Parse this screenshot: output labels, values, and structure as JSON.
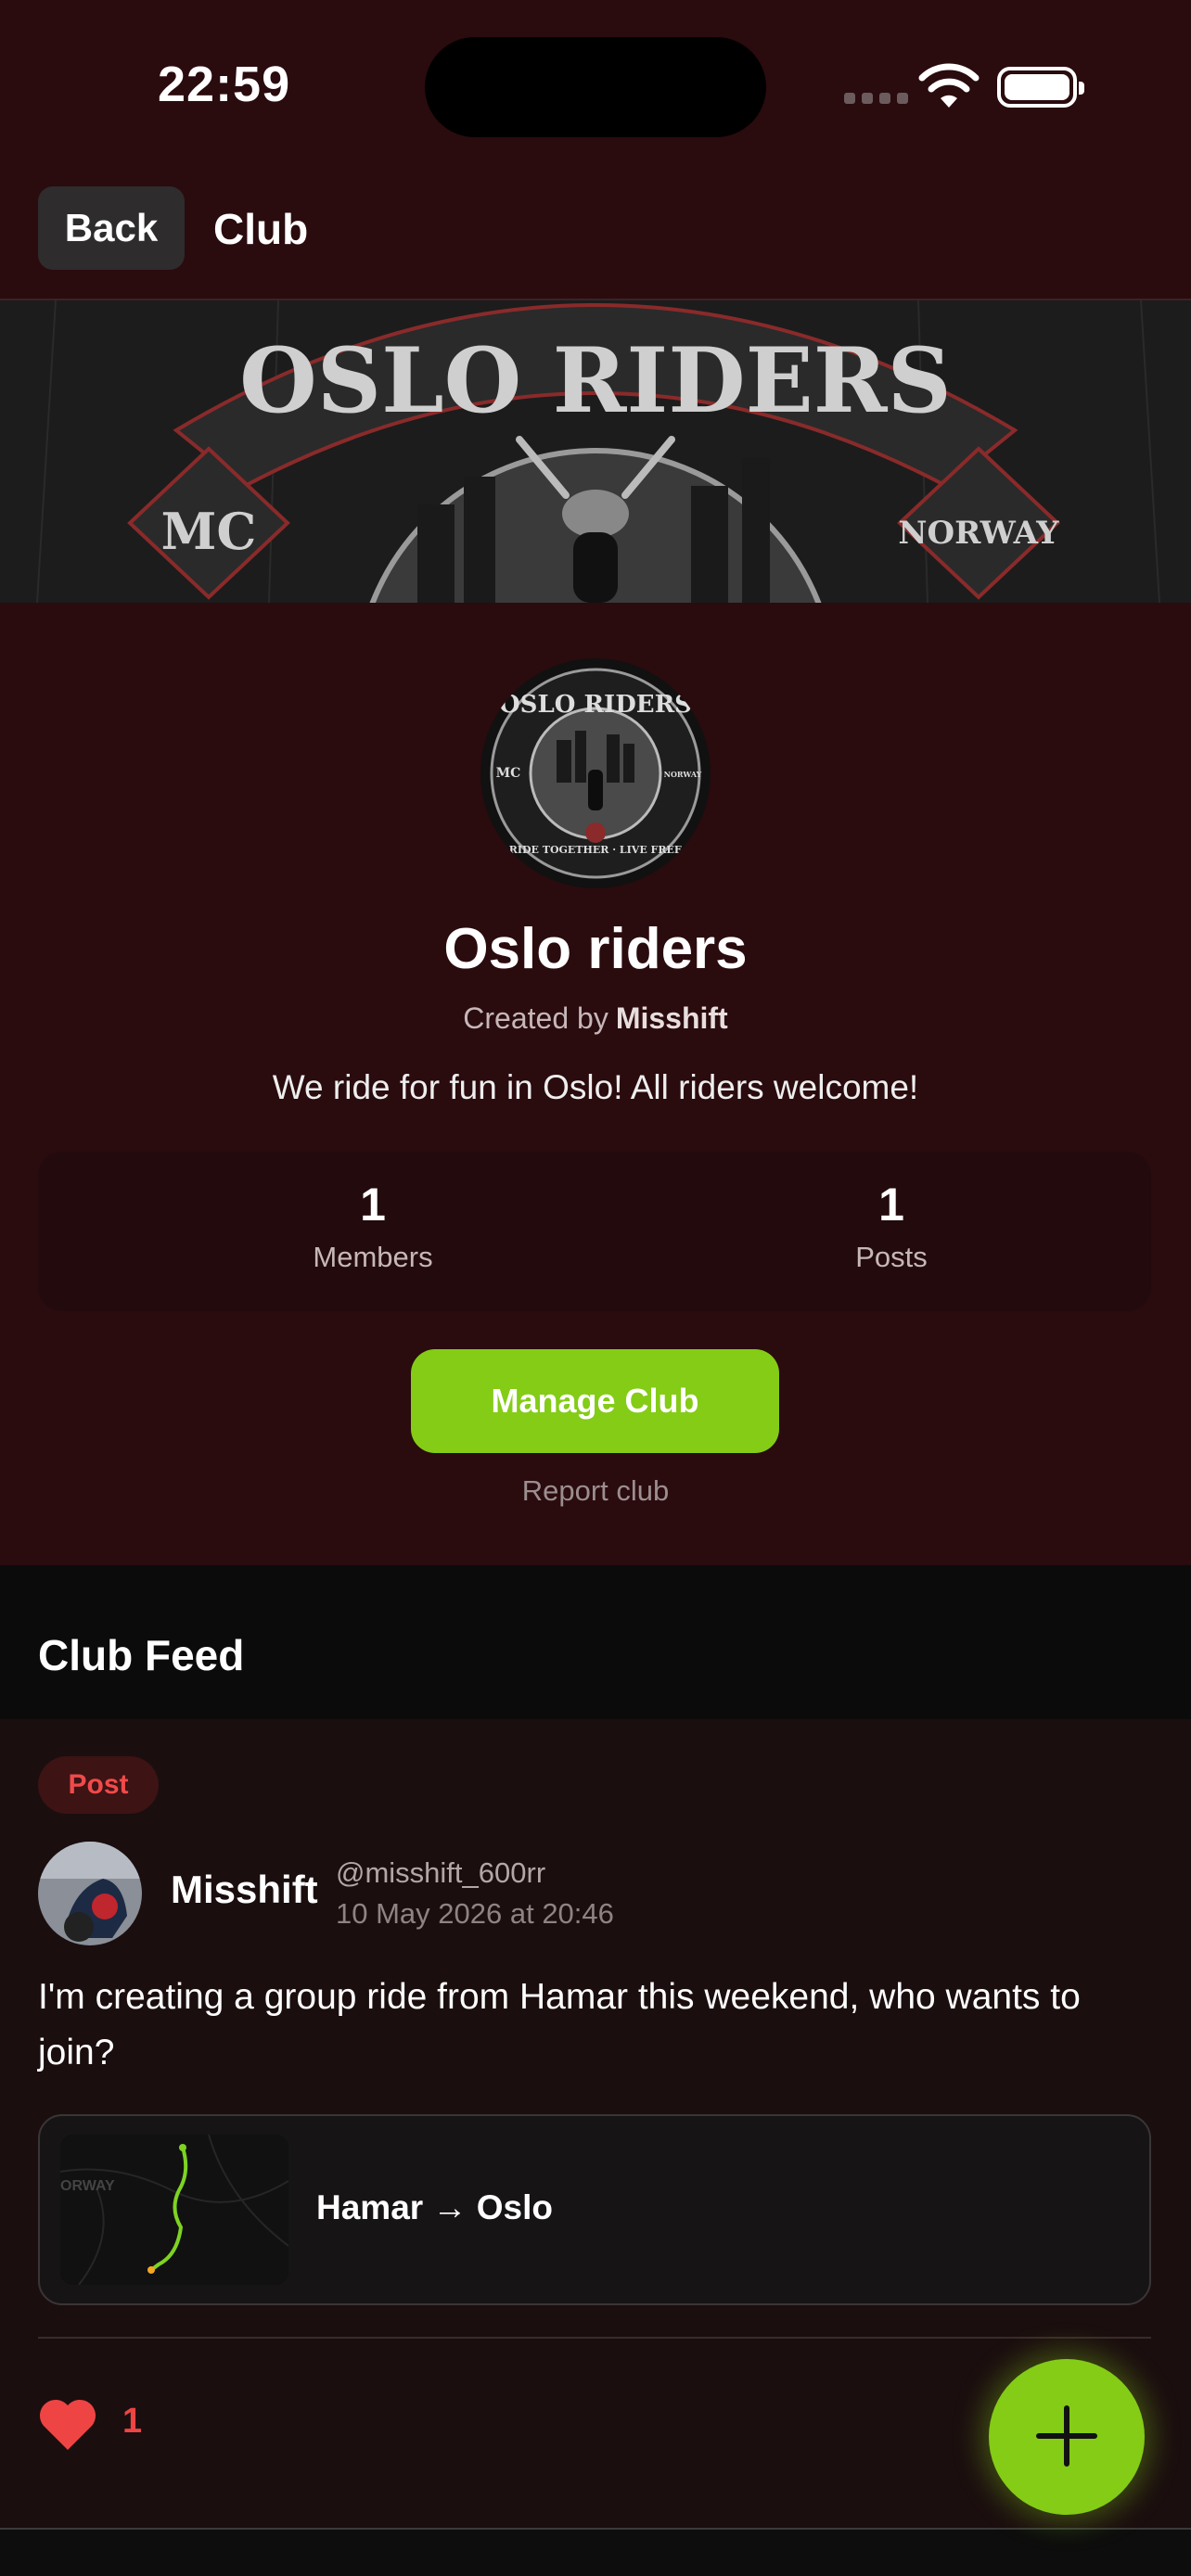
{
  "status_bar": {
    "time": "22:59"
  },
  "nav": {
    "back_label": "Back",
    "title": "Club"
  },
  "banner": {
    "title": "OSLO RIDERS",
    "left_badge": "MC",
    "right_badge": "NORWAY"
  },
  "club": {
    "name": "Oslo riders",
    "created_prefix": "Created by",
    "creator": "Misshift",
    "description": "We ride for fun in Oslo! All riders welcome!",
    "stats": [
      {
        "value": "1",
        "label": "Members"
      },
      {
        "value": "1",
        "label": "Posts"
      }
    ],
    "manage_label": "Manage Club",
    "report_label": "Report club",
    "logo_text": {
      "title": "OSLO RIDERS",
      "left": "MC",
      "right": "NORWAY",
      "motto": "RIDE TOGETHER · LIVE FREE"
    }
  },
  "feed": {
    "title": "Club Feed",
    "posts": [
      {
        "tag": "Post",
        "author": "Misshift",
        "handle": "@misshift_600rr",
        "date": "10 May 2026 at 20:46",
        "text": "I'm creating a group ride from Hamar this weekend, who wants to join?",
        "route": {
          "label": "Hamar → Oslo",
          "map_text": "ORWAY"
        },
        "likes": "1",
        "right_partial": "0"
      }
    ]
  },
  "colors": {
    "accent": "#84cc16",
    "like": "#ef4444",
    "background": "#2a0b0e"
  },
  "icons": {
    "like": "heart-icon",
    "compose": "plus-icon",
    "wifi": "wifi-icon",
    "battery": "battery-icon"
  }
}
